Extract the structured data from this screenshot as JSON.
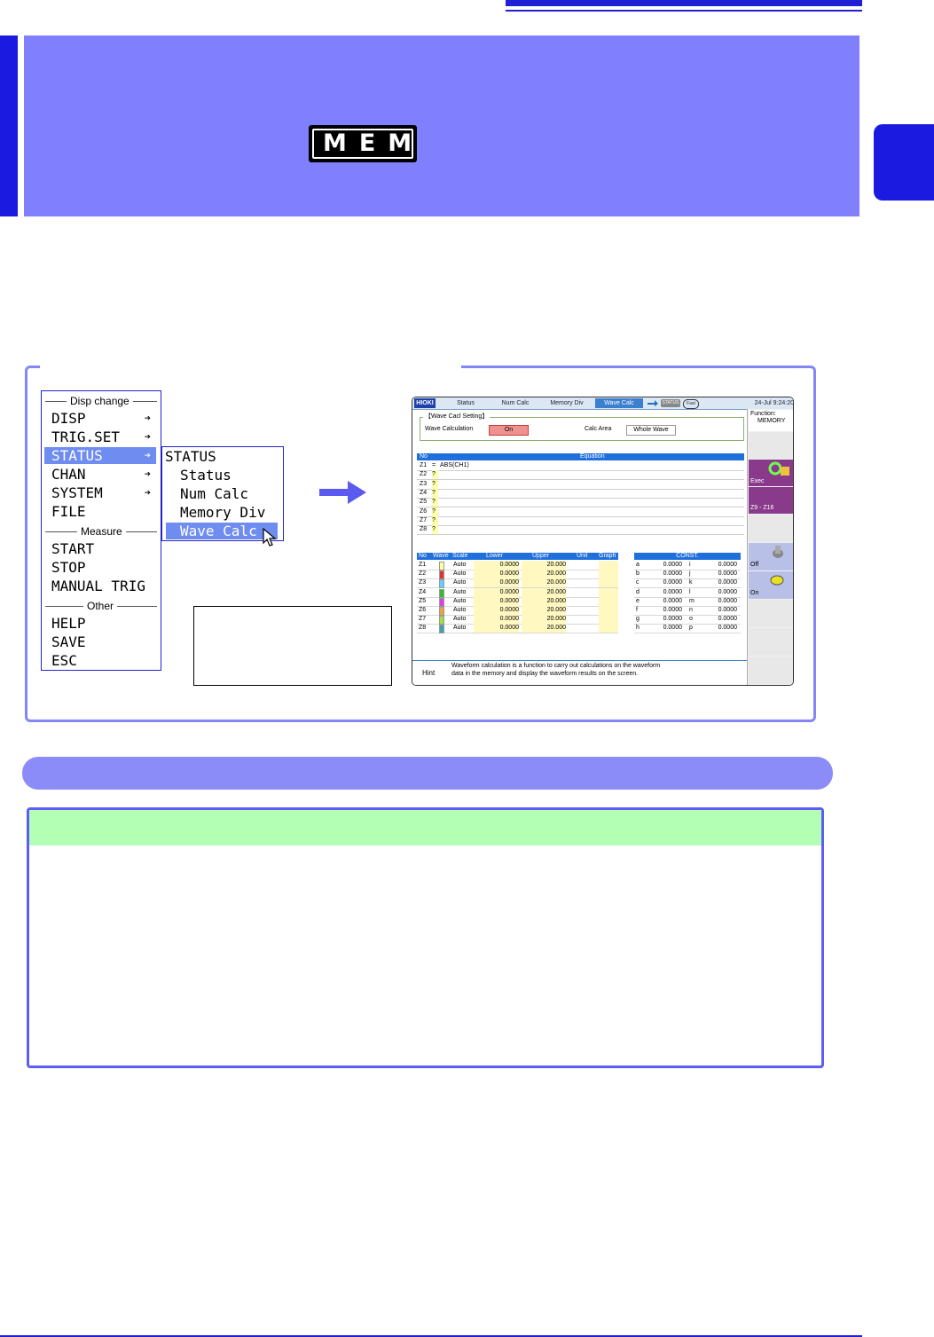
{
  "header": {
    "logo_text": "MEM"
  },
  "menu": {
    "sections": [
      "Disp change",
      "Measure",
      "Other"
    ],
    "items": [
      "DISP",
      "TRIG.SET",
      "STATUS",
      "CHAN",
      "SYSTEM",
      "FILE",
      "START",
      "STOP",
      "MANUAL TRIG",
      "HELP",
      "SAVE",
      "ESC"
    ],
    "arrow_glyph": "➔"
  },
  "submenu": {
    "title": "STATUS",
    "items": [
      "Status",
      "Num Calc",
      "Memory Div",
      "Wave Calc"
    ]
  },
  "screen": {
    "logo": "HIOKI",
    "tabs": [
      "Status",
      "Num Calc",
      "Memory Div",
      "Wave Calc"
    ],
    "status_chip": "STATUS",
    "fast_chip": "Fast",
    "datetime": "24-Jul  9:24:20",
    "function_label": "Function:",
    "function_value": "MEMORY",
    "setting_title": "【Wave Cacl Setting】",
    "wave_calc_label": "Wave Calculation",
    "wave_calc_value": "On",
    "calc_area_label": "Calc Area",
    "calc_area_value": "Whole Wave",
    "eq_headers": [
      "No",
      "Equation"
    ],
    "equations": [
      {
        "no": "Z1",
        "mark": "=",
        "eq": "ABS(CH1)"
      },
      {
        "no": "Z2",
        "mark": "?",
        "eq": ""
      },
      {
        "no": "Z3",
        "mark": "?",
        "eq": ""
      },
      {
        "no": "Z4",
        "mark": "?",
        "eq": ""
      },
      {
        "no": "Z5",
        "mark": "?",
        "eq": ""
      },
      {
        "no": "Z6",
        "mark": "?",
        "eq": ""
      },
      {
        "no": "Z7",
        "mark": "?",
        "eq": ""
      },
      {
        "no": "Z8",
        "mark": "?",
        "eq": ""
      }
    ],
    "scale_headers": [
      "No",
      "Wave",
      "Scale",
      "Lower",
      "Upper",
      "Unit",
      "Graph"
    ],
    "scale_rows": [
      {
        "no": "Z1",
        "color": "#ffffa0",
        "scale": "Auto",
        "lower": "0.0000",
        "upper": "20.000"
      },
      {
        "no": "Z2",
        "color": "#e83030",
        "scale": "Auto",
        "lower": "0.0000",
        "upper": "20.000"
      },
      {
        "no": "Z3",
        "color": "#60d0ff",
        "scale": "Auto",
        "lower": "0.0000",
        "upper": "20.000"
      },
      {
        "no": "Z4",
        "color": "#30c030",
        "scale": "Auto",
        "lower": "0.0000",
        "upper": "20.000"
      },
      {
        "no": "Z5",
        "color": "#e040e0",
        "scale": "Auto",
        "lower": "0.0000",
        "upper": "20.000"
      },
      {
        "no": "Z6",
        "color": "#f0a040",
        "scale": "Auto",
        "lower": "0.0000",
        "upper": "20.000"
      },
      {
        "no": "Z7",
        "color": "#a0e040",
        "scale": "Auto",
        "lower": "0.0000",
        "upper": "20.000"
      },
      {
        "no": "Z8",
        "color": "#40a0b0",
        "scale": "Auto",
        "lower": "0.0000",
        "upper": "20.000"
      }
    ],
    "const_header": "CONST.",
    "consts_left": [
      {
        "k": "a",
        "v": "0.0000"
      },
      {
        "k": "b",
        "v": "0.0000"
      },
      {
        "k": "c",
        "v": "0.0000"
      },
      {
        "k": "d",
        "v": "0.0000"
      },
      {
        "k": "e",
        "v": "0.0000"
      },
      {
        "k": "f",
        "v": "0.0000"
      },
      {
        "k": "g",
        "v": "0.0000"
      },
      {
        "k": "h",
        "v": "0.0000"
      }
    ],
    "consts_right": [
      {
        "k": "i",
        "v": "0.0000"
      },
      {
        "k": "j",
        "v": "0.0000"
      },
      {
        "k": "k",
        "v": "0.0000"
      },
      {
        "k": "l",
        "v": "0.0000"
      },
      {
        "k": "m",
        "v": "0.0000"
      },
      {
        "k": "n",
        "v": "0.0000"
      },
      {
        "k": "o",
        "v": "0.0000"
      },
      {
        "k": "p",
        "v": "0.0000"
      }
    ],
    "right_buttons": [
      "Exec",
      "Z9 - Z16",
      "Off",
      "On"
    ],
    "hint_label": "Hint",
    "hint_line1": "Waveform calculation is a function to carry out calculations on the waveform",
    "hint_line2": "data in the memory and  display the waveform results on the screen."
  }
}
